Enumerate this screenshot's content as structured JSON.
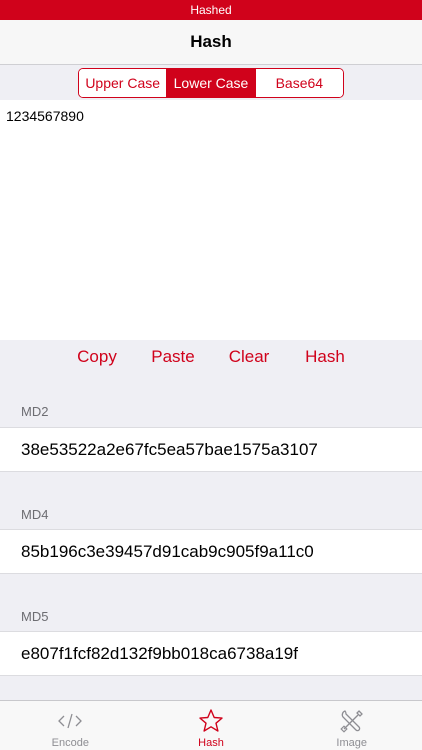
{
  "status_bar": {
    "text": "Hashed"
  },
  "nav": {
    "title": "Hash"
  },
  "segment": {
    "options": [
      "Upper Case",
      "Lower Case",
      "Base64"
    ],
    "selected": "Lower Case"
  },
  "input": {
    "value": "1234567890"
  },
  "actions": {
    "copy": "Copy",
    "paste": "Paste",
    "clear": "Clear",
    "hash": "Hash"
  },
  "results": [
    {
      "label": "MD2",
      "value": "38e53522a2e67fc5ea57bae1575a3107"
    },
    {
      "label": "MD4",
      "value": "85b196c3e39457d91cab9c905f9a11c0"
    },
    {
      "label": "MD5",
      "value": "e807f1fcf82d132f9bb018ca6738a19f"
    }
  ],
  "tabs": [
    {
      "label": "Encode",
      "icon": "code-icon"
    },
    {
      "label": "Hash",
      "icon": "star-icon"
    },
    {
      "label": "Image",
      "icon": "tools-icon"
    }
  ],
  "active_tab": "Hash",
  "colors": {
    "accent": "#d0021b",
    "background": "#efeff4",
    "inactive": "#8e8e93"
  }
}
